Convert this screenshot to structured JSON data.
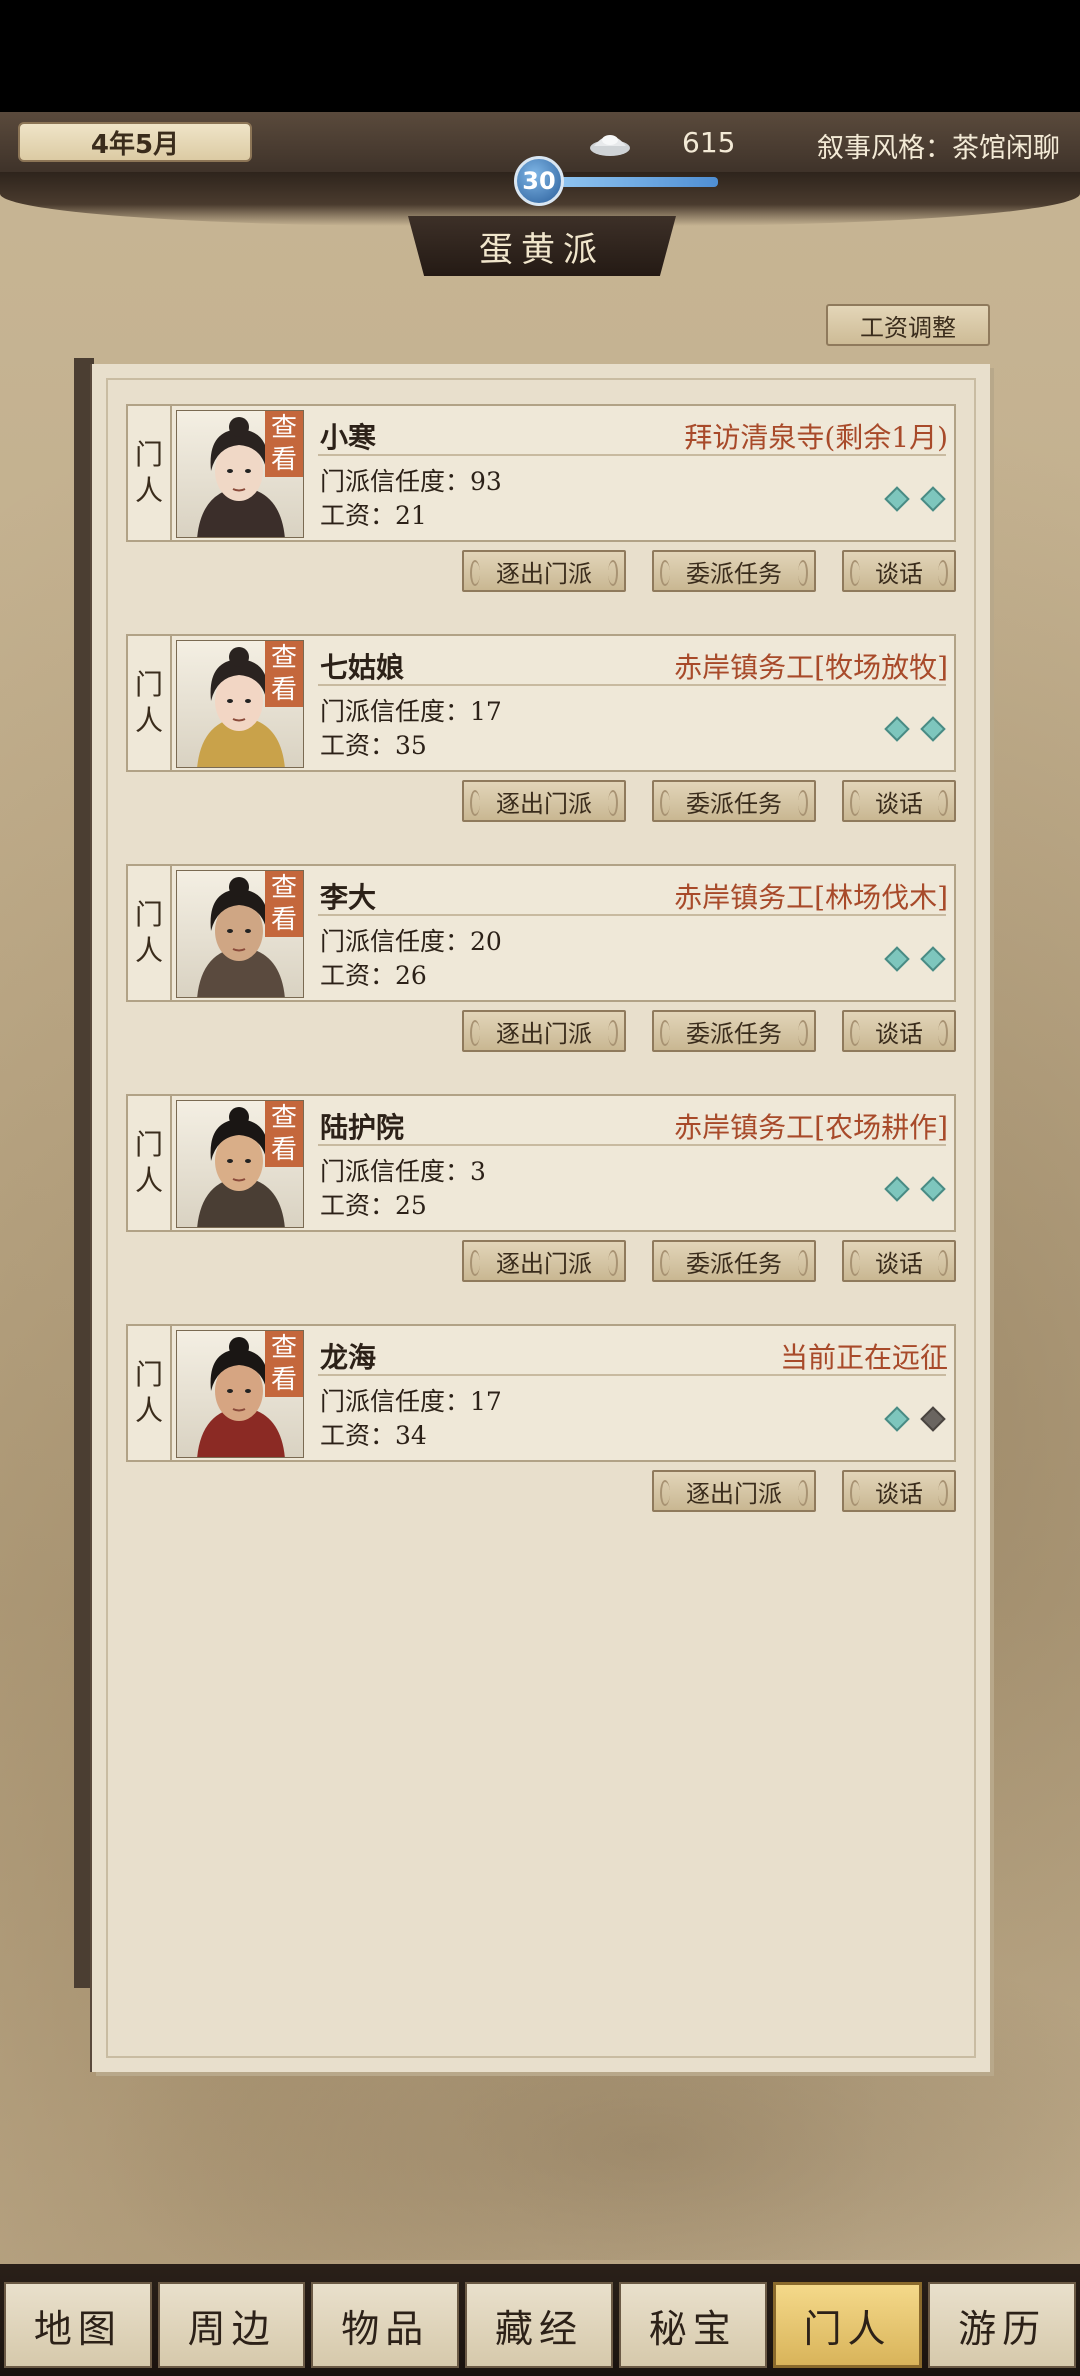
{
  "header": {
    "date": "4年5月",
    "money": "615",
    "narrative_style": "叙事风格：茶馆闲聊",
    "level": "30",
    "level_progress": 0.62,
    "sect_name": "蛋黄派",
    "wage_button": "工资调整"
  },
  "card_common": {
    "tag_top": "门",
    "tag_bottom": "人",
    "view_top": "查",
    "view_bottom": "看",
    "trust_prefix": "门派信任度：",
    "wage_prefix": "工资："
  },
  "members": [
    {
      "name": "小寒",
      "status": "拜访清泉寺(剩余1月)",
      "trust": "93",
      "wage": "21",
      "gems": [
        "active",
        "active"
      ],
      "actions": [
        "逐出门派",
        "委派任务",
        "谈话"
      ]
    },
    {
      "name": "七姑娘",
      "status": "赤岸镇务工[牧场放牧]",
      "trust": "17",
      "wage": "35",
      "gems": [
        "active",
        "active"
      ],
      "actions": [
        "逐出门派",
        "委派任务",
        "谈话"
      ]
    },
    {
      "name": "李大",
      "status": "赤岸镇务工[林场伐木]",
      "trust": "20",
      "wage": "26",
      "gems": [
        "active",
        "active"
      ],
      "actions": [
        "逐出门派",
        "委派任务",
        "谈话"
      ]
    },
    {
      "name": "陆护院",
      "status": "赤岸镇务工[农场耕作]",
      "trust": "3",
      "wage": "25",
      "gems": [
        "active",
        "active"
      ],
      "actions": [
        "逐出门派",
        "委派任务",
        "谈话"
      ]
    },
    {
      "name": "龙海",
      "status": "当前正在远征",
      "trust": "17",
      "wage": "34",
      "gems": [
        "active",
        "inactive"
      ],
      "actions": [
        "逐出门派",
        "谈话"
      ]
    }
  ],
  "nav": {
    "items": [
      "地图",
      "周边",
      "物品",
      "藏经",
      "秘宝",
      "门人",
      "游历"
    ],
    "active": "门人"
  },
  "colors": {
    "status_text": "#a84a2a",
    "view_tag": "#c4673c",
    "gem_active": "#7ec6bd",
    "gem_inactive": "#6a6560",
    "nav_active": "#d9b45a"
  },
  "icons": {
    "currency": "silver-ingot-icon",
    "gem": "diamond-icon"
  }
}
